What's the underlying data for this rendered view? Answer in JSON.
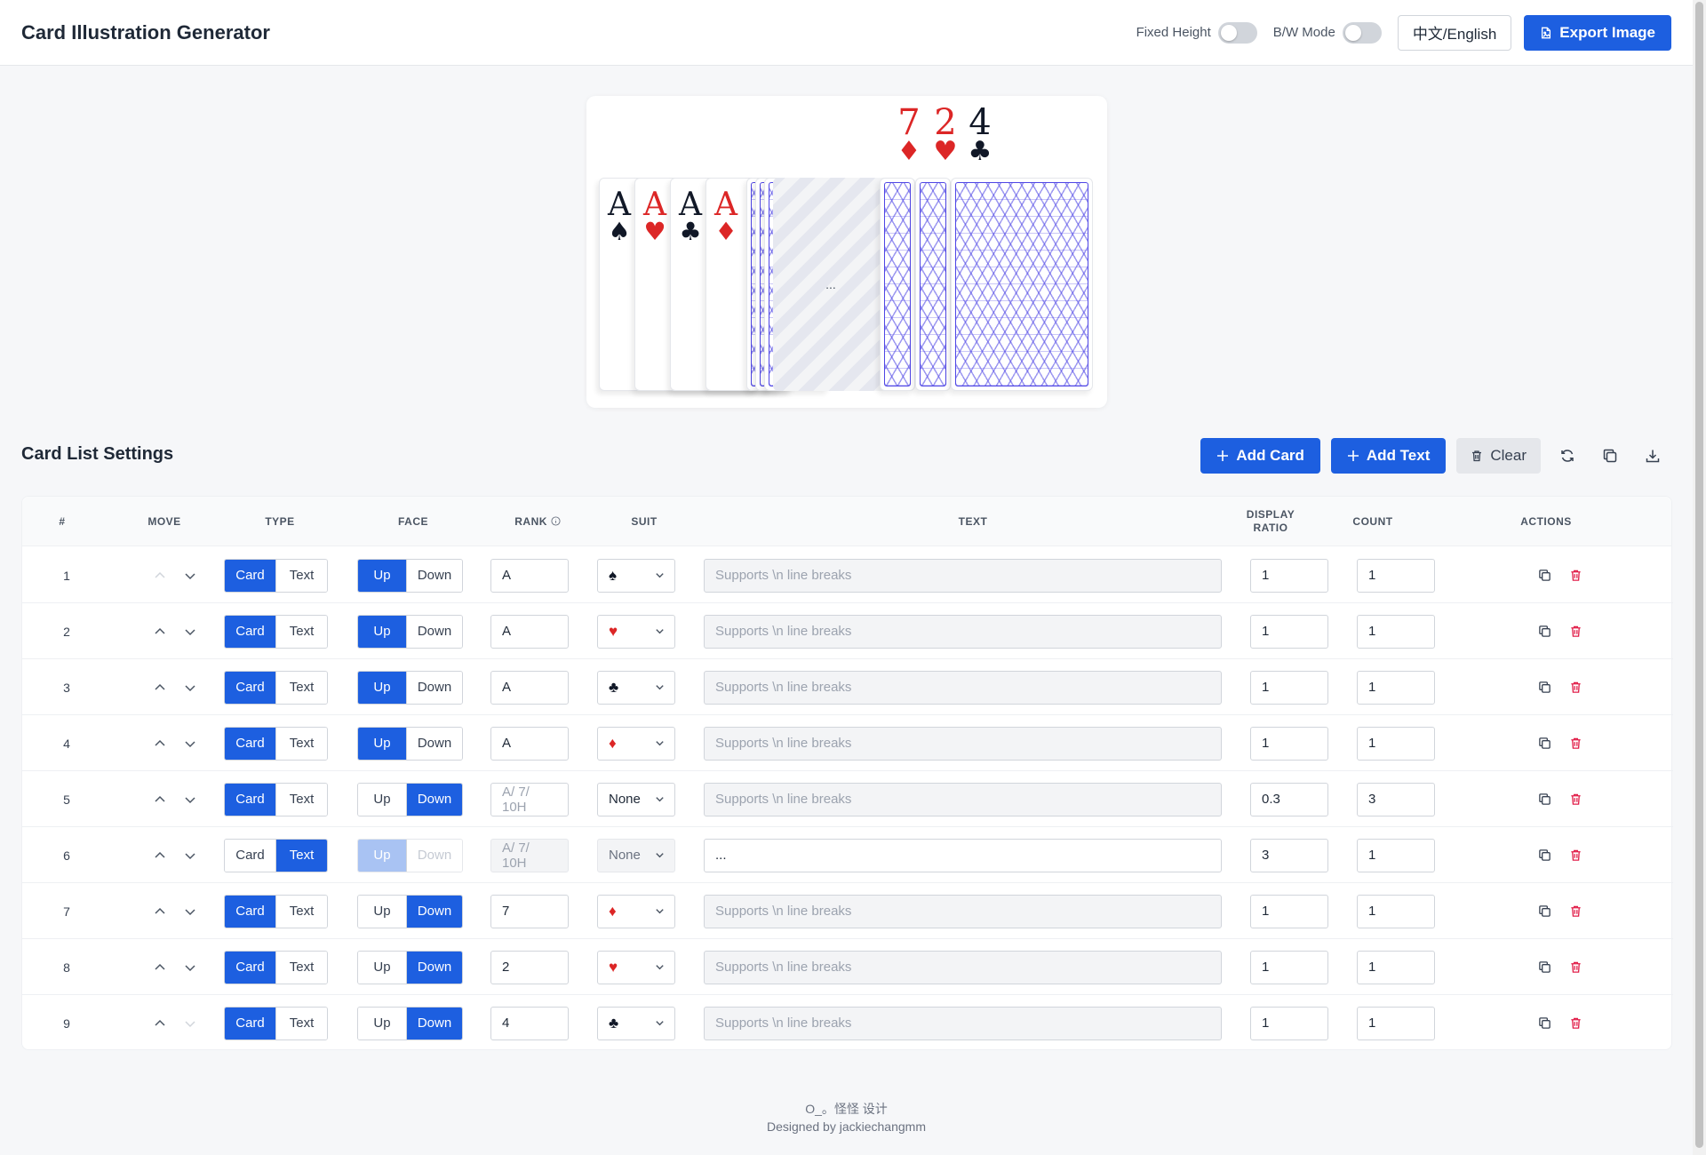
{
  "header": {
    "title": "Card Illustration Generator",
    "fixed_height_label": "Fixed Height",
    "bw_mode_label": "B/W Mode",
    "lang_label": "中文/English",
    "export_label": "Export Image",
    "fixed_height_on": false,
    "bw_mode_on": false
  },
  "preview": {
    "top_cards": [
      {
        "rank": "7",
        "suit": "♦",
        "color": "#dc2626"
      },
      {
        "rank": "2",
        "suit": "♥",
        "color": "#dc2626"
      },
      {
        "rank": "4",
        "suit": "♣",
        "color": "#111827"
      }
    ],
    "face_up_cards": [
      {
        "rank": "A",
        "suit": "♠",
        "color": "#111827"
      },
      {
        "rank": "A",
        "suit": "♥",
        "color": "#dc2626"
      },
      {
        "rank": "A",
        "suit": "♣",
        "color": "#111827"
      },
      {
        "rank": "A",
        "suit": "♦",
        "color": "#dc2626"
      }
    ],
    "text_card": "..."
  },
  "settings": {
    "title": "Card List Settings",
    "add_card_label": "Add Card",
    "add_text_label": "Add Text",
    "clear_label": "Clear",
    "icons": [
      "refresh-icon",
      "copy-icon",
      "download-icon"
    ]
  },
  "table": {
    "headers": {
      "num": "#",
      "move": "Move",
      "type": "Type",
      "face": "Face",
      "rank": "Rank",
      "suit": "Suit",
      "text": "Text",
      "ratio_1": "Display",
      "ratio_2": "Ratio",
      "count": "Count",
      "actions": "Actions"
    },
    "type_options": [
      "Card",
      "Text"
    ],
    "face_options": [
      "Up",
      "Down"
    ],
    "rank_placeholder": "A/ 7/ 10H",
    "text_placeholder": "Supports \\n line breaks",
    "rows": [
      {
        "num": "1",
        "type": "Card",
        "face": "Up",
        "rank": "A",
        "suit": "♠",
        "suit_color": "#111827",
        "text": "",
        "ratio": "1",
        "count": "1",
        "up_disabled": true,
        "down_disabled": false
      },
      {
        "num": "2",
        "type": "Card",
        "face": "Up",
        "rank": "A",
        "suit": "♥",
        "suit_color": "#dc2626",
        "text": "",
        "ratio": "1",
        "count": "1",
        "up_disabled": false,
        "down_disabled": false
      },
      {
        "num": "3",
        "type": "Card",
        "face": "Up",
        "rank": "A",
        "suit": "♣",
        "suit_color": "#111827",
        "text": "",
        "ratio": "1",
        "count": "1",
        "up_disabled": false,
        "down_disabled": false
      },
      {
        "num": "4",
        "type": "Card",
        "face": "Up",
        "rank": "A",
        "suit": "♦",
        "suit_color": "#dc2626",
        "text": "",
        "ratio": "1",
        "count": "1",
        "up_disabled": false,
        "down_disabled": false
      },
      {
        "num": "5",
        "type": "Card",
        "face": "Down",
        "rank": "",
        "suit": "None",
        "suit_color": "#1f2937",
        "text": "",
        "ratio": "0.3",
        "count": "3",
        "up_disabled": false,
        "down_disabled": false
      },
      {
        "num": "6",
        "type": "Text",
        "face": "Up",
        "rank": "",
        "suit": "None",
        "suit_color": "#6b7280",
        "text": "...",
        "ratio": "3",
        "count": "1",
        "up_disabled": false,
        "down_disabled": false
      },
      {
        "num": "7",
        "type": "Card",
        "face": "Down",
        "rank": "7",
        "suit": "♦",
        "suit_color": "#dc2626",
        "text": "",
        "ratio": "1",
        "count": "1",
        "up_disabled": false,
        "down_disabled": false
      },
      {
        "num": "8",
        "type": "Card",
        "face": "Down",
        "rank": "2",
        "suit": "♥",
        "suit_color": "#dc2626",
        "text": "",
        "ratio": "1",
        "count": "1",
        "up_disabled": false,
        "down_disabled": false
      },
      {
        "num": "9",
        "type": "Card",
        "face": "Down",
        "rank": "4",
        "suit": "♣",
        "suit_color": "#111827",
        "text": "",
        "ratio": "1",
        "count": "1",
        "up_disabled": false,
        "down_disabled": true
      }
    ]
  },
  "footer": {
    "line1": "O_。怪怪 设计",
    "line2": "Designed by jackiechangmm"
  },
  "colors": {
    "primary": "#1d5fe0",
    "danger": "#e11d48",
    "red_suit": "#dc2626",
    "card_back": "#4f46e5"
  }
}
